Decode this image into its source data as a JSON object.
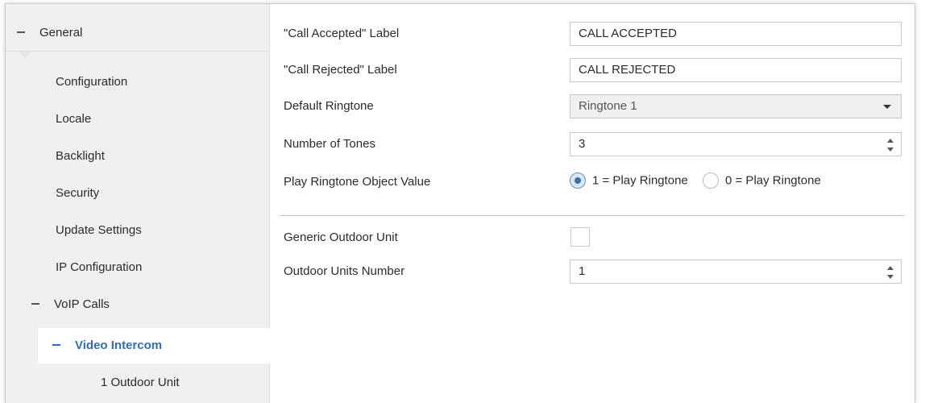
{
  "sidebar": {
    "general": "General",
    "items": [
      "Configuration",
      "Locale",
      "Backlight",
      "Security",
      "Update Settings",
      "IP Configuration"
    ],
    "voip": "VoIP Calls",
    "selected": "Video Intercom",
    "outdoor_unit": "1 Outdoor Unit"
  },
  "form": {
    "call_accepted_label": "\"Call Accepted\" Label",
    "call_accepted_value": "CALL ACCEPTED",
    "call_rejected_label": "\"Call Rejected\" Label",
    "call_rejected_value": "CALL REJECTED",
    "default_ringtone_label": "Default Ringtone",
    "default_ringtone_value": "Ringtone 1",
    "number_of_tones_label": "Number of Tones",
    "number_of_tones_value": "3",
    "play_ringtone_label": "Play Ringtone Object Value",
    "radio_option_1": "1 = Play Ringtone",
    "radio_option_2": "0 = Play Ringtone",
    "radio_selected": "1 = Play Ringtone",
    "generic_outdoor_label": "Generic Outdoor Unit",
    "generic_outdoor_checked": false,
    "outdoor_units_label": "Outdoor Units Number",
    "outdoor_units_value": "1"
  },
  "colors": {
    "accent": "#2e6fb6",
    "sidebar_bg": "#f0f0f0",
    "border": "#c8c8c8"
  },
  "icons": [
    "collapse-dash-icon",
    "dropdown-caret-icon",
    "spin-up-icon",
    "spin-down-icon"
  ]
}
